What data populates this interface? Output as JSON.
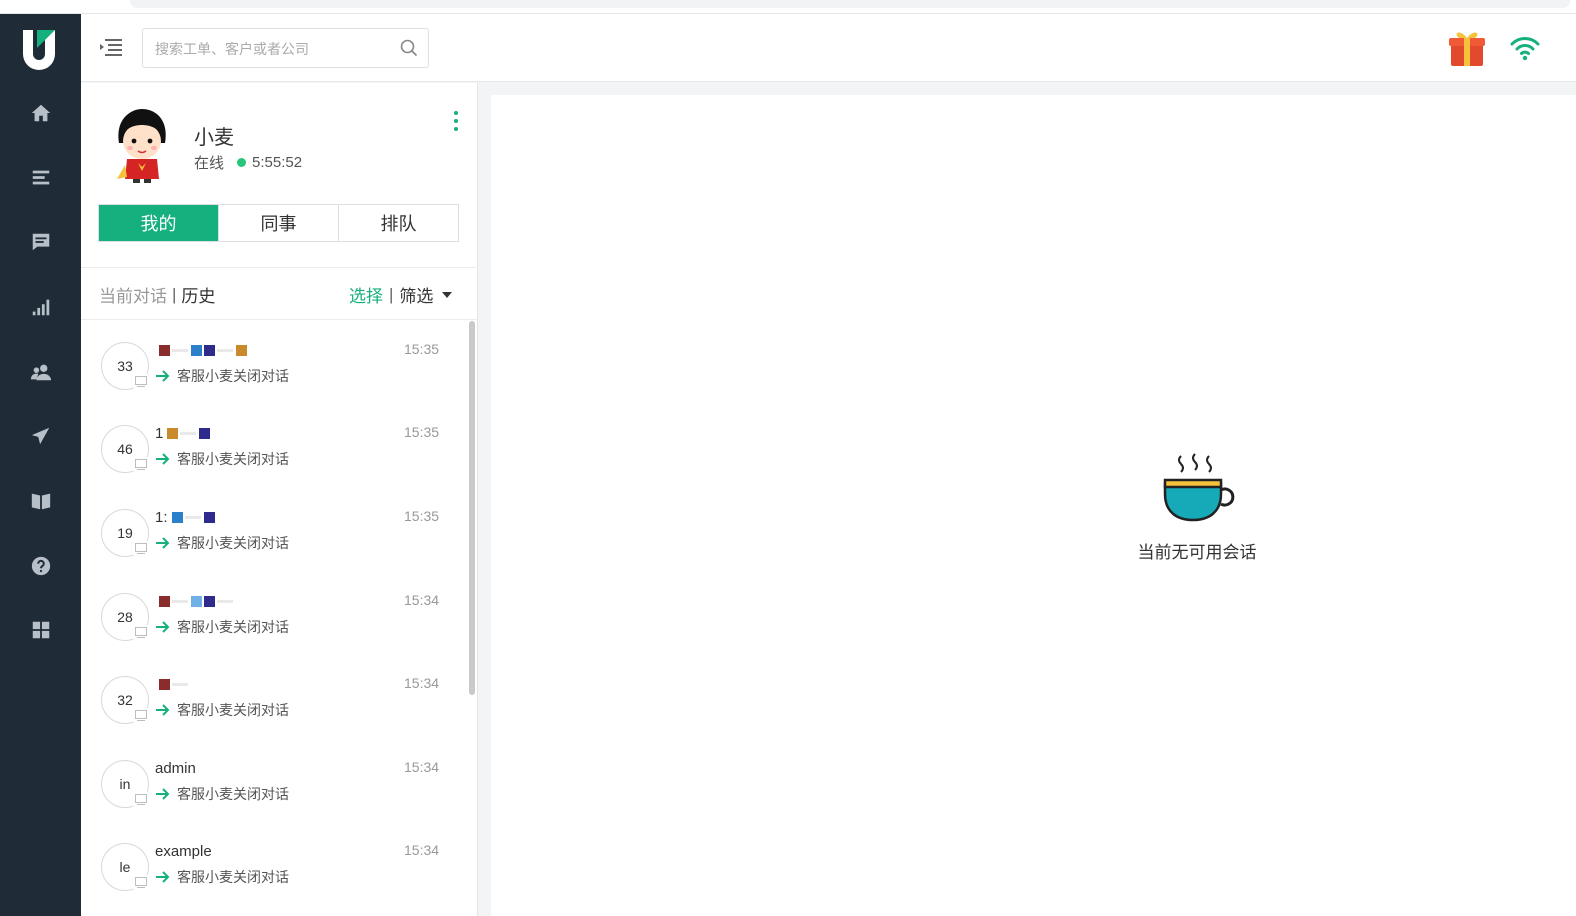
{
  "header": {
    "search_placeholder": "搜索工单、客户或者公司"
  },
  "sidebar": {
    "items": [
      {
        "name": "home-icon"
      },
      {
        "name": "tickets-icon"
      },
      {
        "name": "chat-icon"
      },
      {
        "name": "stats-icon"
      },
      {
        "name": "customers-icon"
      },
      {
        "name": "send-icon"
      },
      {
        "name": "knowledge-icon"
      },
      {
        "name": "help-icon"
      },
      {
        "name": "apps-icon"
      }
    ]
  },
  "agent": {
    "name": "小麦",
    "status": "在线",
    "online_time": "5:55:52"
  },
  "tabs": [
    "我的",
    "同事",
    "排队"
  ],
  "subtabs": {
    "current": "当前对话",
    "history": "历史",
    "select": "选择",
    "filter": "筛选"
  },
  "conversations": [
    {
      "badge": "33",
      "name": "",
      "time": "15:35",
      "last": "客服小麦关闭对话",
      "swatches": [
        "#8b2c2c",
        "#2b80c9",
        "#2e2b8c",
        "#c98a2b"
      ]
    },
    {
      "badge": "46",
      "name": "1",
      "time": "15:35",
      "last": "客服小麦关闭对话",
      "swatches": [
        "#c98a2b",
        "#2e2b8c"
      ]
    },
    {
      "badge": "19",
      "name": "1:",
      "time": "15:35",
      "last": "客服小麦关闭对话",
      "swatches": [
        "#2b80c9",
        "#2e2b8c"
      ]
    },
    {
      "badge": "28",
      "name": "",
      "time": "15:34",
      "last": "客服小麦关闭对话",
      "swatches": [
        "#8b2c2c",
        "#6fb0e6",
        "#2e2b8c"
      ]
    },
    {
      "badge": "32",
      "name": "",
      "time": "15:34",
      "last": "客服小麦关闭对话",
      "swatches": [
        "#8b2c2c"
      ]
    },
    {
      "badge": "in",
      "name": "admin",
      "time": "15:34",
      "last": "客服小麦关闭对话",
      "swatches": []
    },
    {
      "badge": "le",
      "name": "example",
      "time": "15:34",
      "last": "客服小麦关闭对话",
      "swatches": []
    }
  ],
  "empty_state": {
    "text": "当前无可用会话",
    "icon": "coffee-cup-icon"
  },
  "colors": {
    "accent": "#16b07f",
    "sidebar": "#1f2b36",
    "cup": "#16a9b8"
  }
}
